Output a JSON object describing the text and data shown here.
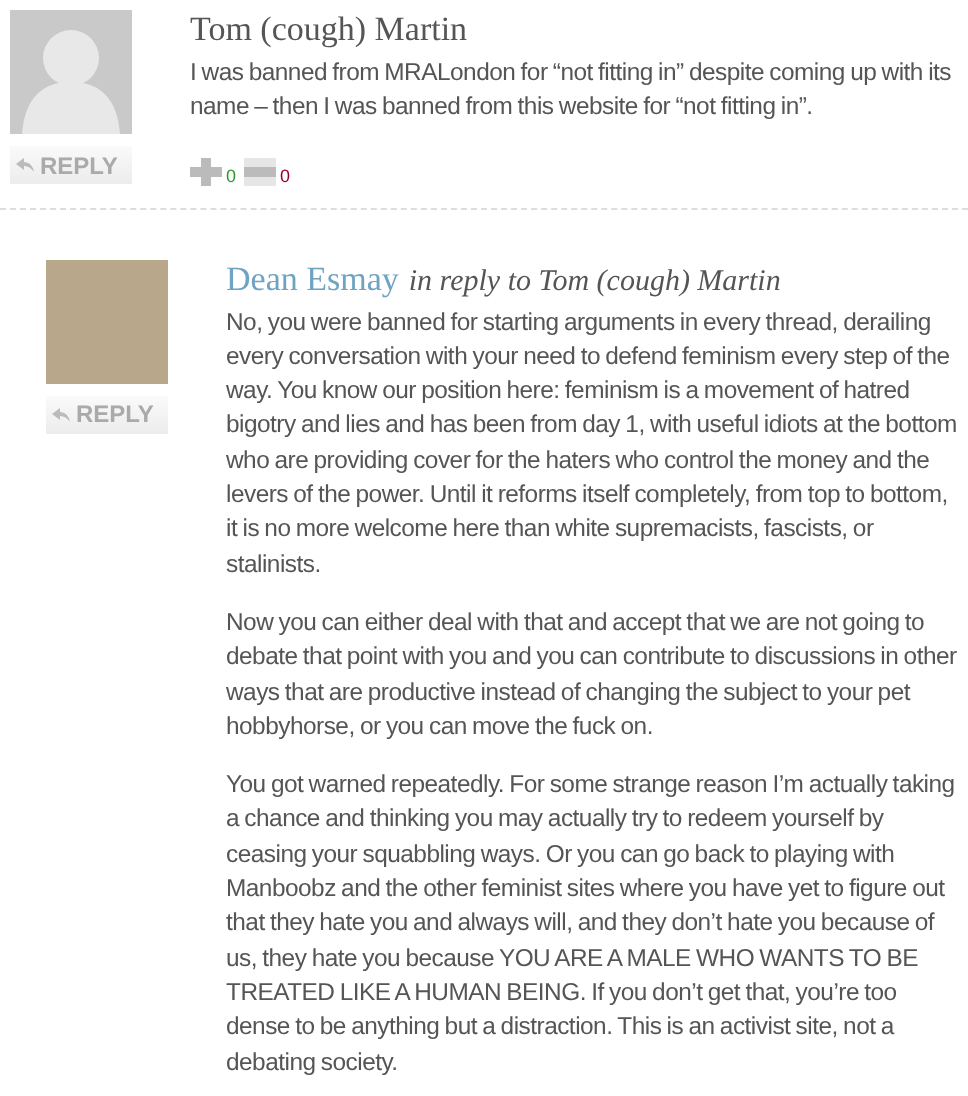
{
  "comments": [
    {
      "author": "Tom (cough) Martin",
      "author_link": false,
      "avatar": {
        "kind": "silhouette"
      },
      "reply_button": "REPLY",
      "paragraphs": [
        "I was banned from MRALondon for “not fitting in” despite coming up with its name – then I was banned from this website for “not fitting in”."
      ],
      "votes": [
        {
          "kind": "up",
          "count": "0"
        },
        {
          "kind": "down",
          "count": "0"
        }
      ],
      "replies": [
        {
          "author": "Dean Esmay",
          "author_link": true,
          "in_reply_to": "in reply to Tom (cough) Martin",
          "avatar": {
            "kind": "photo"
          },
          "reply_button": "REPLY",
          "paragraphs": [
            "No, you were banned for starting arguments in every thread, derailing every conversation with your need to defend feminism every step of the way. You know our position here: feminism is a movement of hatred bigotry and lies and has been from day 1, with useful idiots at the bottom who are providing cover for the haters who control the money and the levers of the power. Until it reforms itself completely, from top to bottom, it is no more welcome here than white supremacists, fascists, or stalinists.",
            "Now you can either deal with that and accept that we are not going to debate that point with you and you can contribute to discussions in other ways that are productive instead of changing the subject to your pet hobbyhorse, or you can move the fuck on.",
            "You got warned repeatedly. For some strange reason I’m actually taking a chance and thinking you may actually try to redeem yourself by ceasing your squabbling ways. Or you can go back to playing with Manboobz and the other feminist sites where you have yet to figure out that they hate you and always will, and they don’t hate you because of us, they hate you because YOU ARE A MALE WHO WANTS TO BE TREATED LIKE A HUMAN BEING. If you don’t get that, you’re too dense to be anything but a distraction. This is an activist site, not a debating society."
          ]
        }
      ]
    }
  ]
}
